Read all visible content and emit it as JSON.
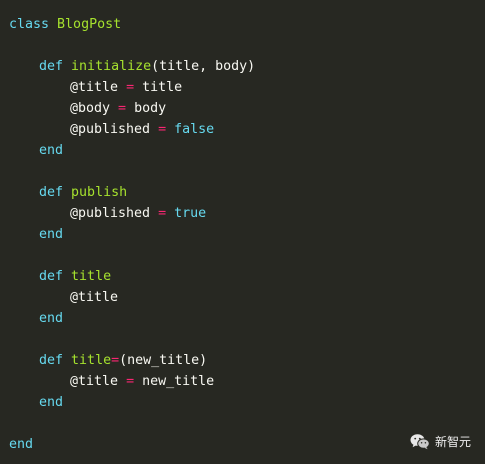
{
  "code": {
    "class_kw": "class",
    "class_name": "BlogPost",
    "def_kw": "def",
    "end_kw": "end",
    "init_name": "initialize",
    "init_params": "(title, body)",
    "ivar_title": "@title",
    "ivar_body": "@body",
    "ivar_published": "@published",
    "assign": "=",
    "val_title": "title",
    "val_body": "body",
    "val_false": "false",
    "val_true": "true",
    "publish_name": "publish",
    "title_name": "title",
    "title_setter_name": "title",
    "setter_eq": "=",
    "setter_params": "(new_title)",
    "val_new_title": "new_title"
  },
  "watermark": {
    "icon": "wechat-icon",
    "text": "新智元"
  }
}
